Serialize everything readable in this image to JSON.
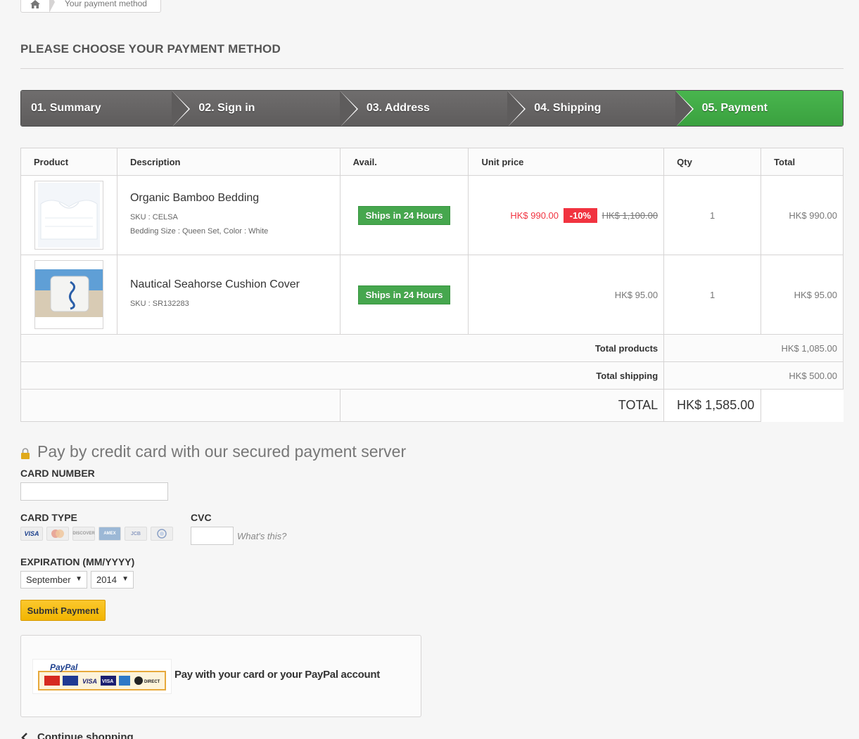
{
  "breadcrumb": {
    "home_icon": "home-icon",
    "current": "Your payment method"
  },
  "page_heading": "PLEASE CHOOSE YOUR PAYMENT METHOD",
  "steps": [
    {
      "label": "01. Summary"
    },
    {
      "label": "02. Sign in"
    },
    {
      "label": "03. Address"
    },
    {
      "label": "04. Shipping"
    },
    {
      "label": "05. Payment"
    }
  ],
  "cart": {
    "headers": {
      "product": "Product",
      "description": "Description",
      "avail": "Avail.",
      "unit_price": "Unit price",
      "qty": "Qty",
      "total": "Total"
    },
    "items": [
      {
        "name": "Organic Bamboo Bedding",
        "sku": "SKU : CELSA",
        "attributes": "Bedding Size : Queen Set, Color : White",
        "availability": "Ships in 24 Hours",
        "price": "HK$ 990.00",
        "discount": "-10%",
        "old_price": "HK$ 1,100.00",
        "qty": "1",
        "total": "HK$ 990.00"
      },
      {
        "name": "Nautical Seahorse Cushion Cover",
        "sku": "SKU : SR132283",
        "availability": "Ships in 24 Hours",
        "price": "HK$ 95.00",
        "qty": "1",
        "total": "HK$ 95.00"
      }
    ],
    "total_products_label": "Total products",
    "total_products": "HK$ 1,085.00",
    "total_shipping_label": "Total shipping",
    "total_shipping": "HK$ 500.00",
    "grand_total_label": "TOTAL",
    "grand_total": "HK$ 1,585.00"
  },
  "payment": {
    "title": "Pay by credit card with our secured payment server",
    "card_number_label": "CARD NUMBER",
    "card_number_value": "",
    "card_type_label": "CARD TYPE",
    "card_types": [
      "VISA",
      "MC",
      "DISCOVER",
      "AMEX",
      "JCB",
      "DINERS"
    ],
    "cvc_label": "CVC",
    "cvc_value": "",
    "whats_this": "What's this?",
    "expiration_label": "EXPIRATION (MM/YYYY)",
    "month_selected": "September",
    "year_selected": "2014",
    "submit_label": "Submit Payment"
  },
  "paypal": {
    "logo_text": "PayPal",
    "label": "Pay with your card or your PayPal account"
  },
  "continue_label": "Continue shopping",
  "colors": {
    "step_active": "#46a74e",
    "step_inactive": "#666464",
    "sale_red": "#f13340",
    "submit_yellow": "#f6bd13"
  }
}
